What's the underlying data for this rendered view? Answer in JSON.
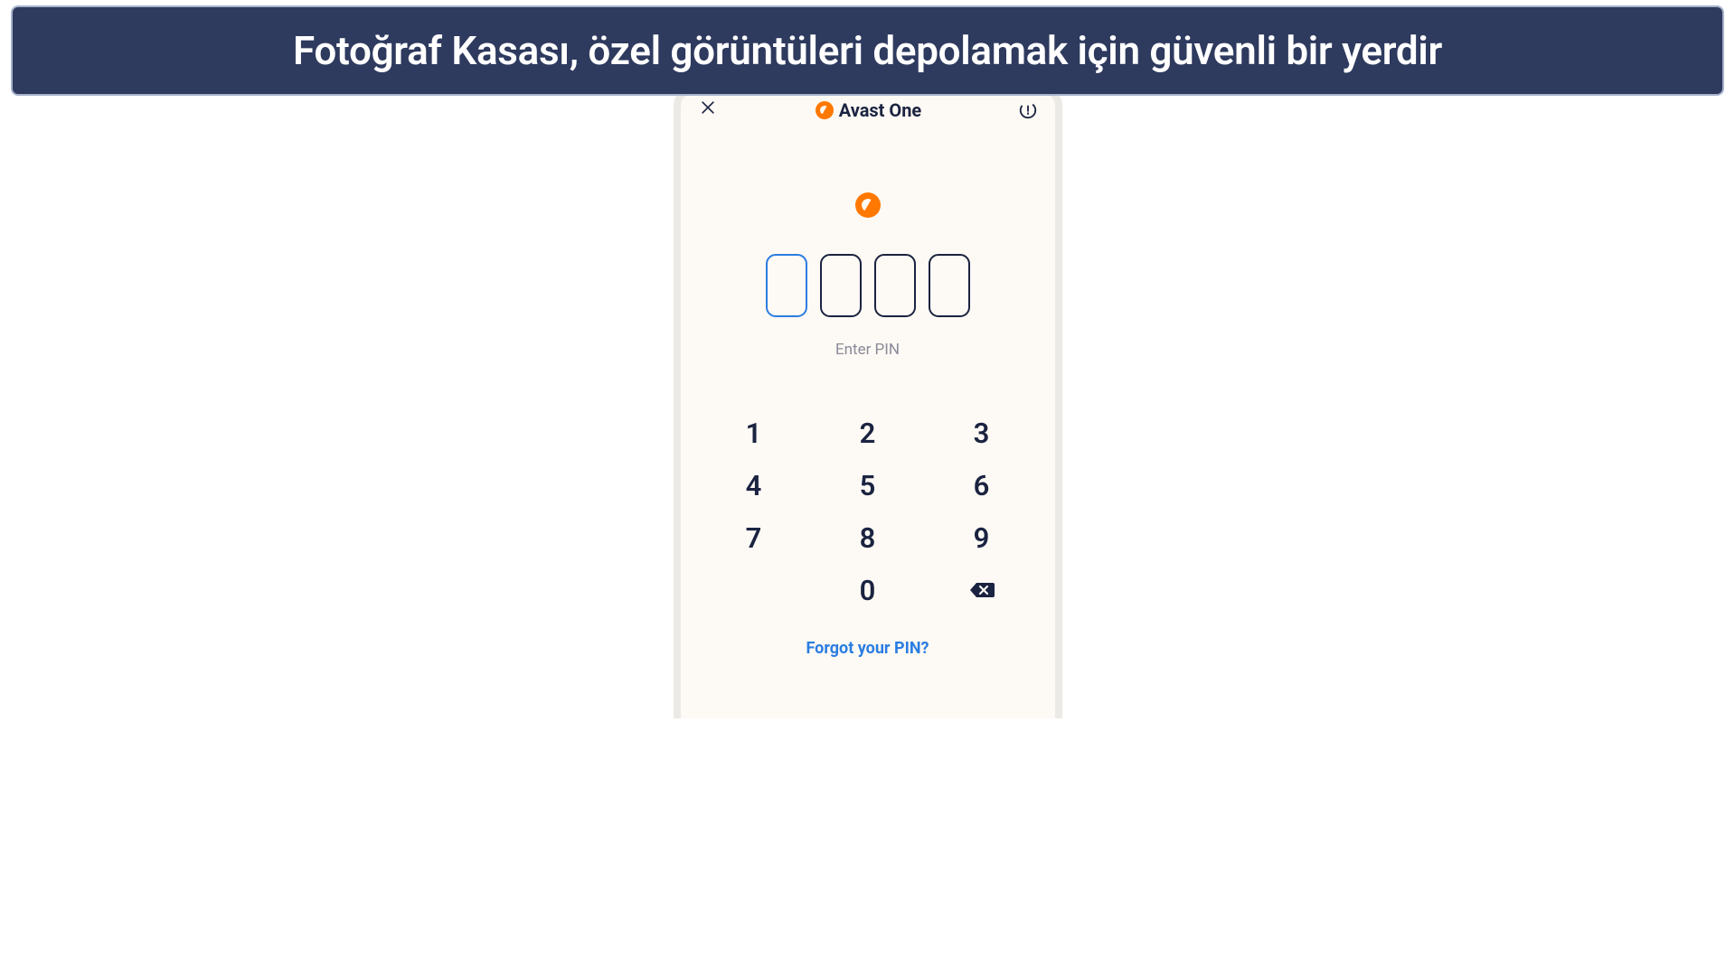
{
  "banner": {
    "text": "Fotoğraf Kasası, özel görüntüleri depolamak için güvenli bir yerdir"
  },
  "header": {
    "app_title": "Avast One"
  },
  "pin": {
    "prompt": "Enter PIN",
    "digit_count": 4,
    "active_index": 0
  },
  "keypad": {
    "keys": [
      [
        "1",
        "2",
        "3"
      ],
      [
        "4",
        "5",
        "6"
      ],
      [
        "7",
        "8",
        "9"
      ],
      [
        "",
        "0",
        "backspace"
      ]
    ]
  },
  "footer": {
    "forgot_pin": "Forgot your PIN?"
  },
  "colors": {
    "banner_bg": "#2e3a5e",
    "accent_orange": "#ff7800",
    "accent_blue": "#2a7de1",
    "text_dark": "#1a2340",
    "phone_bg": "#fdf9f4"
  }
}
